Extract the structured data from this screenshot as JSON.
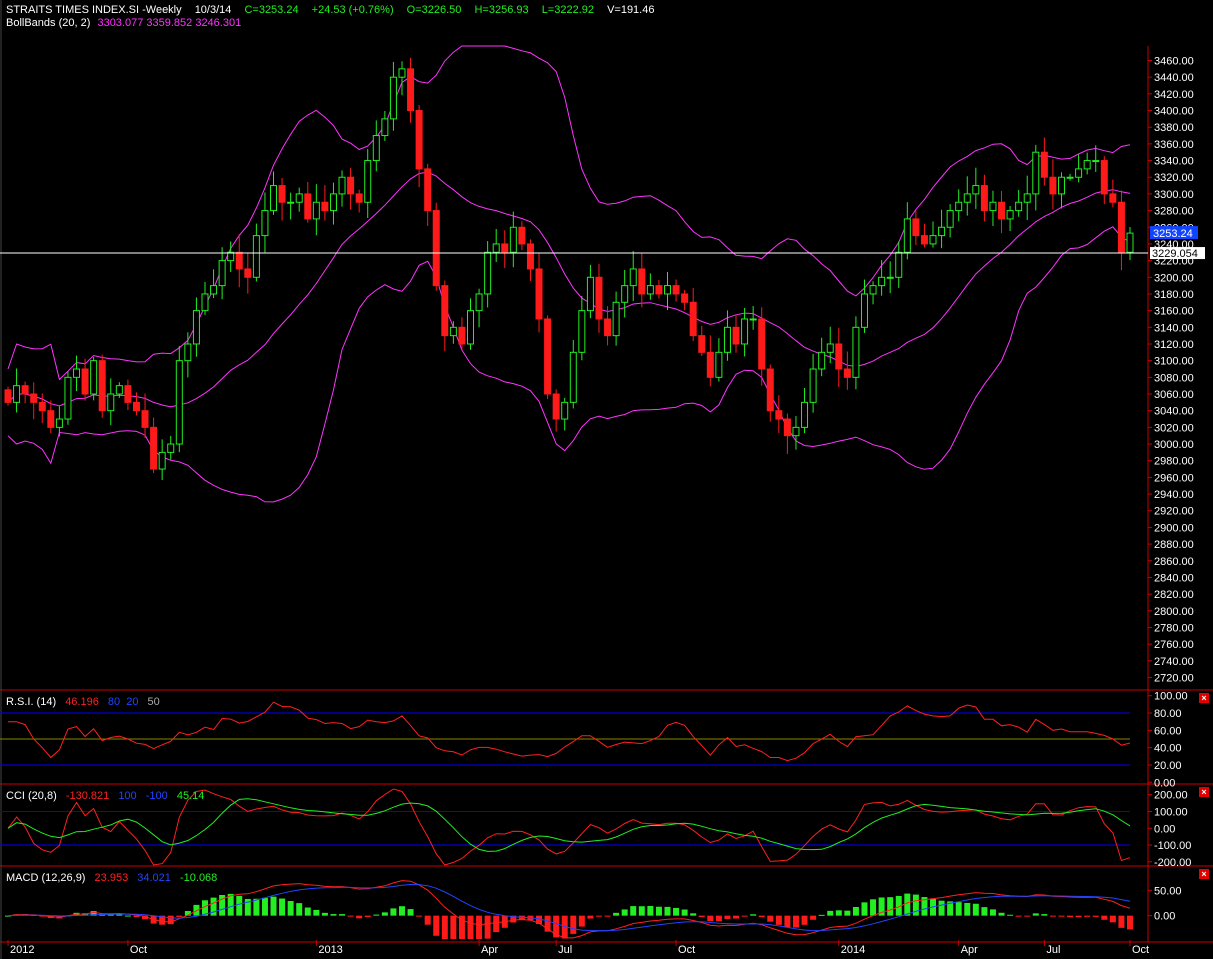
{
  "header": {
    "symbol": "STRAITS TIMES INDEX.SI -Weekly",
    "date": "10/3/14",
    "close": "C=3253.24",
    "change": "+24.53 (+0.76%)",
    "open": "O=3226.50",
    "high": "H=3256.93",
    "low": "L=3222.92",
    "volume": "V=191.46"
  },
  "bbands_label": {
    "name": "BollBands (20, 2)",
    "values": "3303.077 3359.852 3246.301"
  },
  "rsi_label": {
    "name": "R.S.I. (14)",
    "value": "46.196",
    "v80": "80",
    "v20": "20",
    "v50": "50"
  },
  "cci_label": {
    "name": "CCI (20,8)",
    "value": "-130.821",
    "v100": "100",
    "vm100": "-100",
    "signal": "45.14"
  },
  "macd_label": {
    "name": "MACD (12,26,9)",
    "macd": "23.953",
    "signal": "34.021",
    "hist": "-10.068"
  },
  "colors": {
    "up": "#22ee22",
    "down": "#ff1a1a",
    "band": "#ff33ff",
    "grid_frame": "#cc0000",
    "level_line": "#0000ff",
    "rsi_line": "#ff2020",
    "cci_signal": "#22ee22",
    "macd_signal": "#2244ff"
  },
  "chart_data": [
    {
      "type": "candlestick",
      "timeframe": "weekly",
      "x_labels": [
        "2012",
        "Oct",
        "2013",
        "Apr",
        "Jul",
        "Oct",
        "2014",
        "Apr",
        "Jul",
        "Oct"
      ],
      "y_ticks": [
        2720,
        2740,
        2760,
        2780,
        2800,
        2820,
        2840,
        2860,
        2880,
        2900,
        2920,
        2940,
        2960,
        2980,
        3000,
        3020,
        3040,
        3060,
        3080,
        3100,
        3120,
        3140,
        3160,
        3180,
        3200,
        3220,
        3240,
        3260,
        3280,
        3300,
        3320,
        3340,
        3360,
        3380,
        3400,
        3420,
        3440,
        3460
      ],
      "ylim": [
        2705,
        3475
      ],
      "last_price_label": "3253.24",
      "horizontal_line": 3229.054,
      "horizontal_line_label": "3229.054",
      "close": [
        3050,
        3070,
        3060,
        3050,
        3040,
        3020,
        3030,
        3080,
        3090,
        3060,
        3100,
        3040,
        3060,
        3070,
        3050,
        3040,
        3020,
        2970,
        2990,
        3000,
        3100,
        3120,
        3160,
        3180,
        3190,
        3220,
        3230,
        3210,
        3200,
        3250,
        3280,
        3310,
        3290,
        3290,
        3300,
        3270,
        3290,
        3280,
        3300,
        3320,
        3300,
        3290,
        3340,
        3370,
        3390,
        3440,
        3450,
        3400,
        3330,
        3280,
        3190,
        3130,
        3140,
        3120,
        3160,
        3180,
        3230,
        3240,
        3230,
        3260,
        3240,
        3210,
        3150,
        3060,
        3030,
        3050,
        3110,
        3160,
        3200,
        3150,
        3130,
        3170,
        3190,
        3210,
        3180,
        3190,
        3180,
        3190,
        3180,
        3170,
        3130,
        3110,
        3080,
        3110,
        3140,
        3120,
        3150,
        3150,
        3090,
        3040,
        3030,
        3010,
        3020,
        3050,
        3090,
        3110,
        3120,
        3090,
        3080,
        3140,
        3180,
        3190,
        3200,
        3200,
        3230,
        3270,
        3250,
        3240,
        3250,
        3260,
        3280,
        3290,
        3300,
        3310,
        3280,
        3290,
        3270,
        3280,
        3290,
        3300,
        3350,
        3320,
        3300,
        3320,
        3320,
        3330,
        3340,
        3340,
        3300,
        3290,
        3230,
        3253
      ],
      "series": [
        {
          "name": "BollBands (20, 2)",
          "values": [
            "3303.077",
            "3359.852",
            "3246.301"
          ]
        }
      ]
    },
    {
      "type": "line",
      "title": "R.S.I. (14)",
      "y_ticks": [
        0,
        20,
        40,
        60,
        80,
        100
      ],
      "ylim": [
        -2,
        102
      ],
      "levels": [
        80,
        50,
        20
      ],
      "last_value": 46.196
    },
    {
      "type": "line",
      "title": "CCI (20,8)",
      "y_ticks": [
        -200,
        -100,
        0,
        100,
        200
      ],
      "ylim": [
        -225,
        240
      ],
      "levels": [
        100,
        -100
      ],
      "last_value": -130.821,
      "signal_last": 45.14
    },
    {
      "type": "bar",
      "title": "MACD (12,26,9)",
      "y_ticks": [
        0,
        50
      ],
      "ylim": [
        -48,
        90
      ],
      "macd_last": 23.953,
      "signal_last": 34.021,
      "hist_last": -10.068
    }
  ]
}
